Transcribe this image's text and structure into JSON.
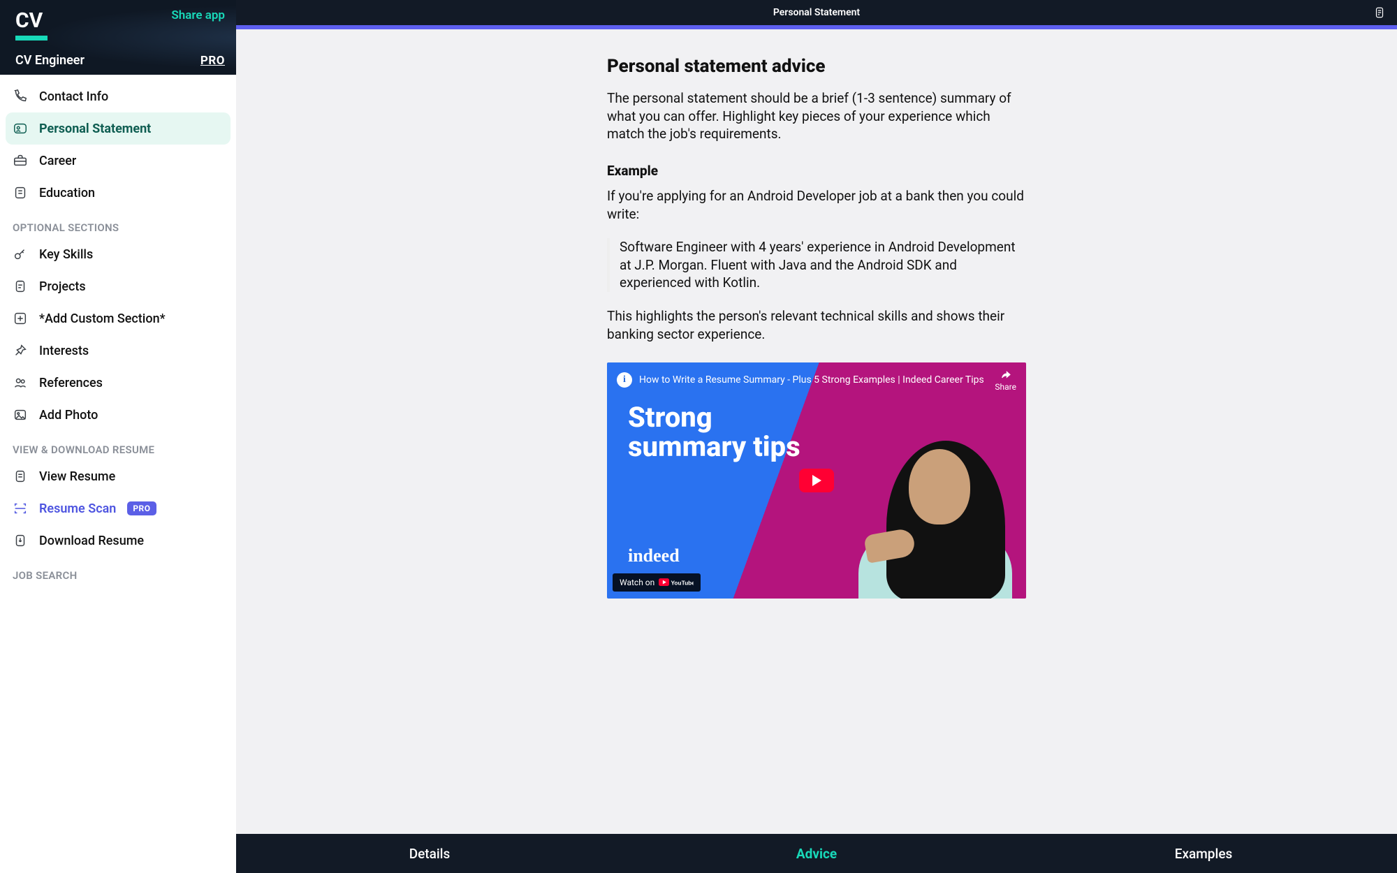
{
  "header": {
    "logo": "CV",
    "share": "Share app",
    "app_name": "CV Engineer",
    "pro": "PRO",
    "title": "Personal Statement"
  },
  "sidebar": {
    "main": [
      {
        "label": "Contact Info"
      },
      {
        "label": "Personal Statement"
      },
      {
        "label": "Career"
      },
      {
        "label": "Education"
      }
    ],
    "optional_heading": "OPTIONAL SECTIONS",
    "optional": [
      {
        "label": "Key Skills"
      },
      {
        "label": "Projects"
      },
      {
        "label": "*Add Custom Section*"
      },
      {
        "label": "Interests"
      },
      {
        "label": "References"
      },
      {
        "label": "Add Photo"
      }
    ],
    "view_heading": "VIEW & DOWNLOAD RESUME",
    "view": [
      {
        "label": "View Resume"
      },
      {
        "label": "Resume Scan",
        "pro": "PRO"
      },
      {
        "label": "Download Resume"
      }
    ],
    "jobsearch_heading": "JOB SEARCH"
  },
  "advice": {
    "heading": "Personal statement advice",
    "p1": "The personal statement should be a brief (1-3 sentence) summary of what you can offer. Highlight key pieces of your experience which match the job's requirements.",
    "example_heading": "Example",
    "p2": "If you're applying for an Android Developer job at a bank then you could write:",
    "example": "Software Engineer with 4 years' experience in Android Development at J.P. Morgan. Fluent with Java and the Android SDK and experienced with Kotlin.",
    "p3": "This highlights the person's relevant technical skills and shows their banking sector experience."
  },
  "video": {
    "title": "How to Write a Resume Summary - Plus 5 Strong Examples | Indeed Career Tips",
    "overlay": "Strong summary tips",
    "share": "Share",
    "watch_on": "Watch on",
    "brand": "indeed"
  },
  "tabs": {
    "details": "Details",
    "advice": "Advice",
    "examples": "Examples"
  }
}
